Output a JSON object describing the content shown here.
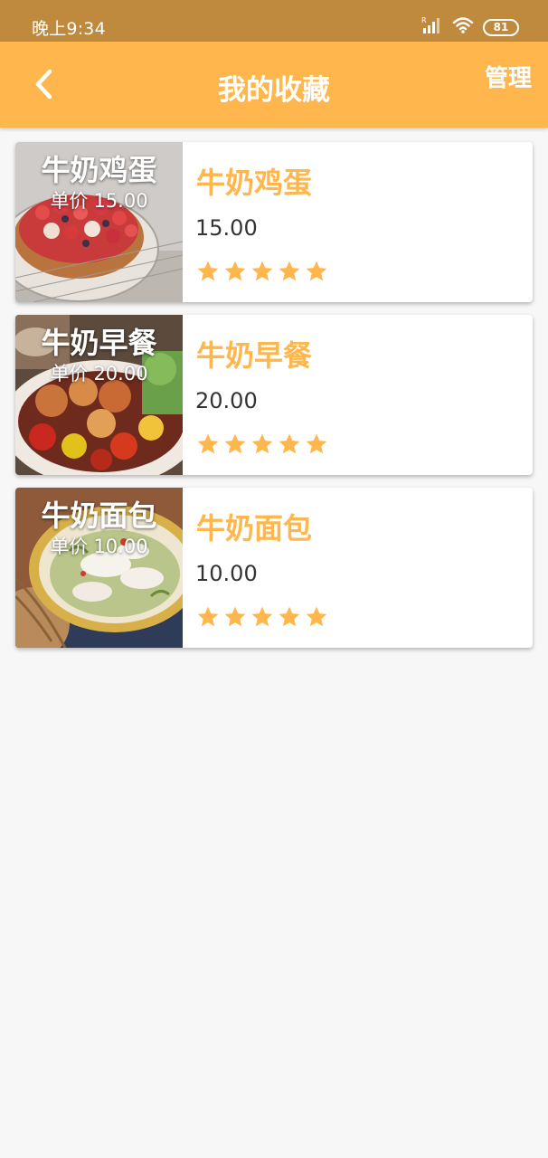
{
  "status_bar": {
    "time": "晚上9:34",
    "battery": "81",
    "signal_tag": "R"
  },
  "header": {
    "back_icon": "chevron-left-icon",
    "title": "我的收藏",
    "manage": "管理"
  },
  "price_label": "单价",
  "colors": {
    "accent": "#ffb74d",
    "status_bar": "#c08a3e",
    "background": "#f7f7f7"
  },
  "items": [
    {
      "name": "牛奶鸡蛋",
      "price": "15.00",
      "rating": 5,
      "image": "strawberry-tart"
    },
    {
      "name": "牛奶早餐",
      "price": "20.00",
      "rating": 5,
      "image": "stir-fry-dish"
    },
    {
      "name": "牛奶面包",
      "price": "10.00",
      "rating": 5,
      "image": "fish-soup"
    }
  ]
}
